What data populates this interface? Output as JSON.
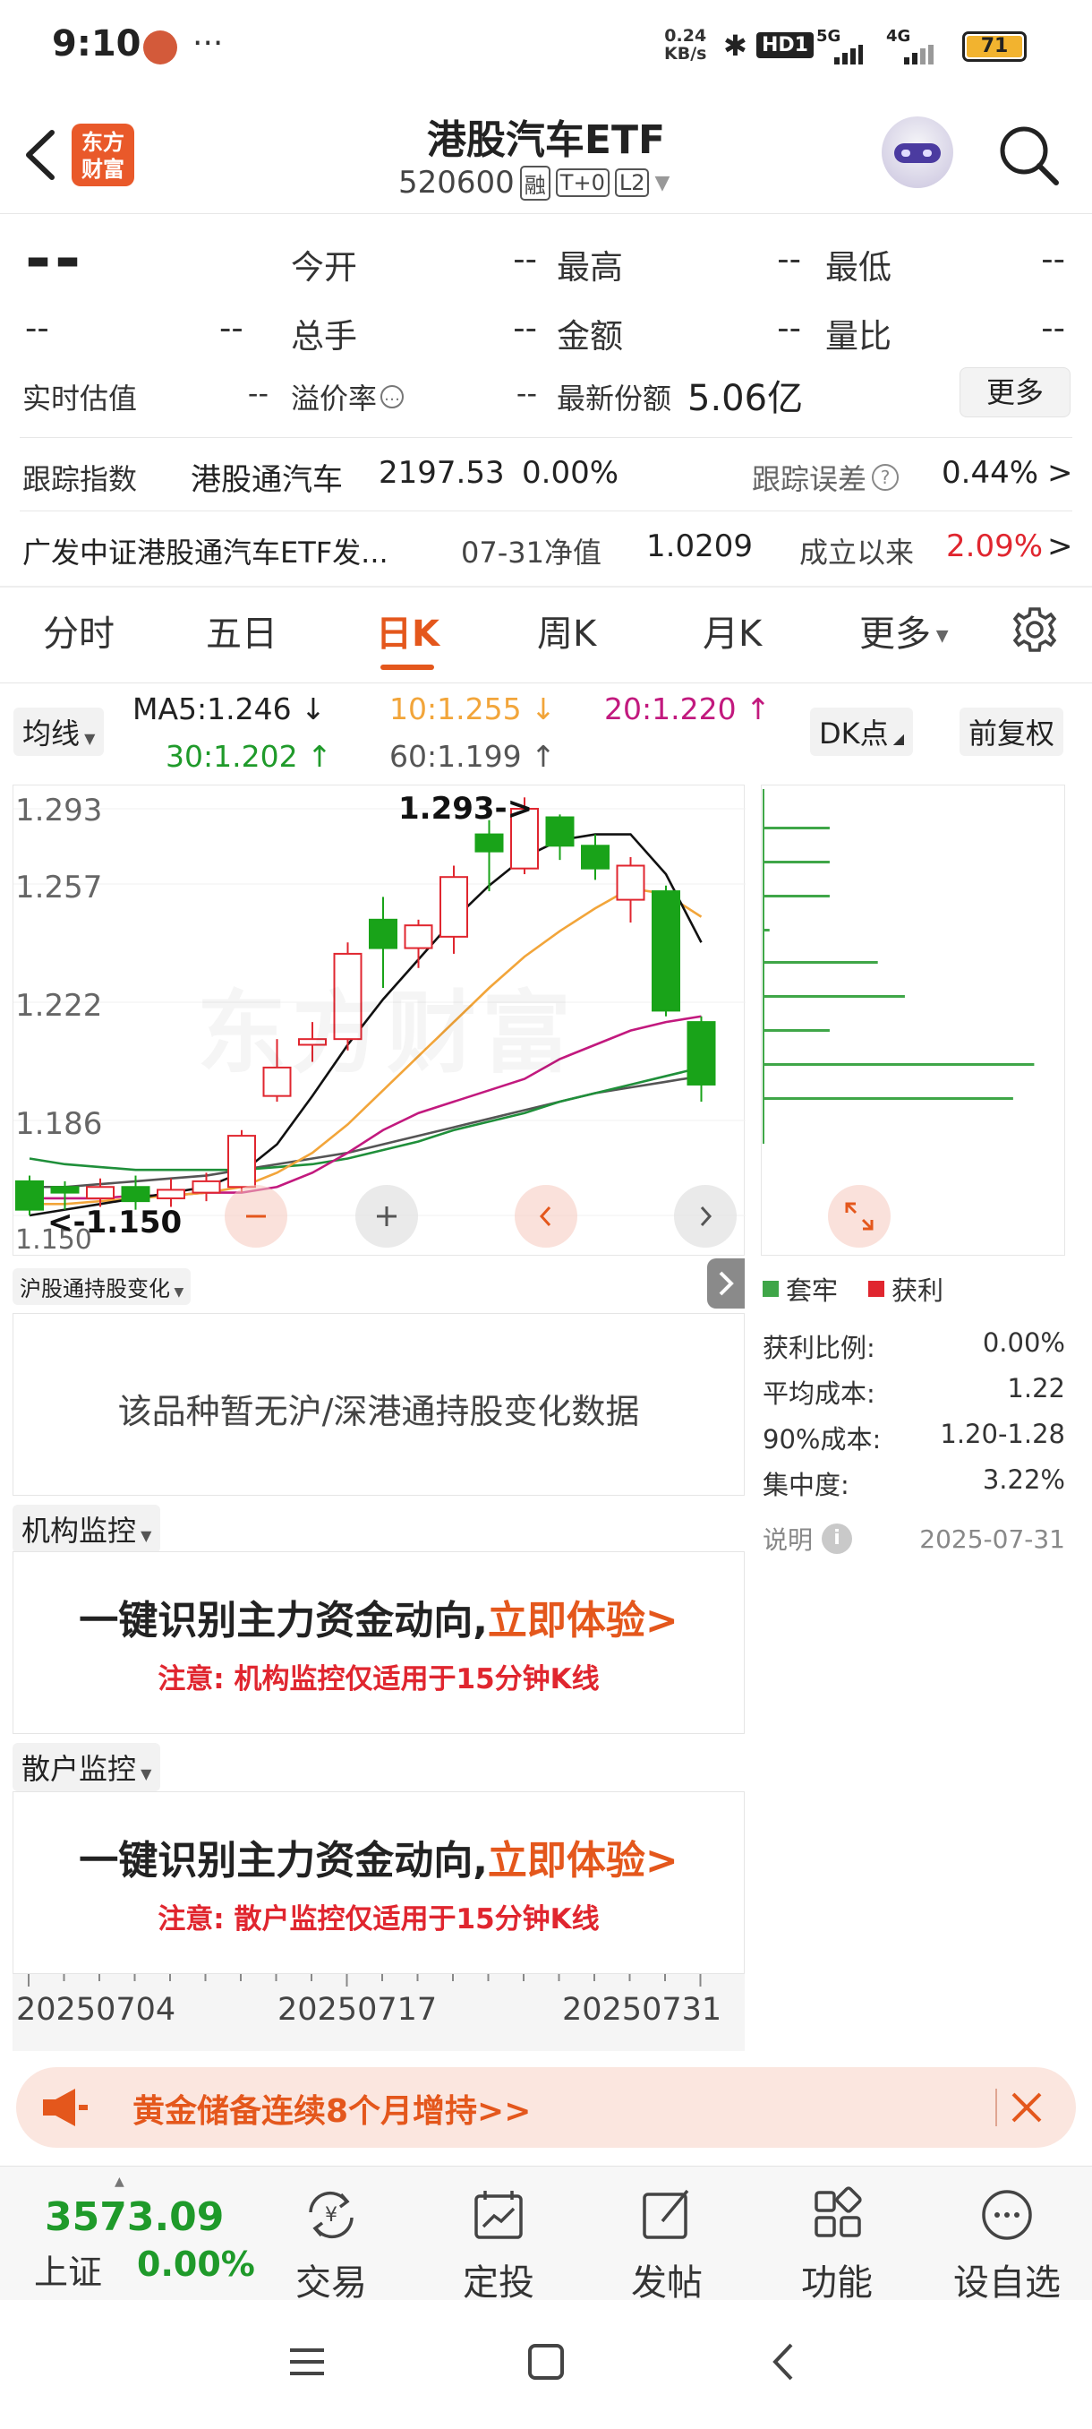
{
  "status_bar": {
    "time": "9:10",
    "dots": "···",
    "net_speed_top": "0.24",
    "net_speed_bottom": "KB/s",
    "hd": "HD1",
    "five_g": "5G",
    "four_g": "4G",
    "battery": "71"
  },
  "header": {
    "logo_line1": "东方",
    "logo_line2": "财富",
    "title": "港股汽车ETF",
    "code": "520600",
    "badge_rong": "融",
    "badge_t0": "T+0",
    "badge_l2": "L2"
  },
  "quote": {
    "price": "--",
    "change": "--",
    "change_pct": "--",
    "open_label": "今开",
    "open": "--",
    "high_label": "最高",
    "high": "--",
    "low_label": "最低",
    "low": "--",
    "volume_label": "总手",
    "volume": "--",
    "amount_label": "金额",
    "amount": "--",
    "ratio_label": "量比",
    "ratio": "--",
    "iopv_label": "实时估值",
    "iopv": "--",
    "premium_label": "溢价率",
    "premium": "--",
    "shares_label": "最新份额",
    "shares": "5.06亿",
    "more_btn": "更多"
  },
  "tracking": {
    "label": "跟踪指数",
    "index_name": "港股通汽车",
    "index_value": "2197.53",
    "index_change": "0.00%",
    "error_label": "跟踪误差",
    "error_value": "0.44%",
    "arrow": ">"
  },
  "fund": {
    "name": "广发中证港股通汽车ETF发...",
    "nav_label": "07-31净值",
    "nav": "1.0209",
    "since_label": "成立以来",
    "since": "2.09%",
    "arrow": ">"
  },
  "tabs": [
    "分时",
    "五日",
    "日K",
    "周K",
    "月K",
    "更多"
  ],
  "chart_header": {
    "ma_btn": "均线",
    "ma5": "MA5:1.246",
    "ma5_arrow": "↓",
    "ma10": "10:1.255",
    "ma10_arrow": "↓",
    "ma20": "20:1.220",
    "ma20_arrow": "↑",
    "ma30": "30:1.202",
    "ma30_arrow": "↑",
    "ma60": "60:1.199",
    "ma60_arrow": "↑",
    "dk_btn": "DK点",
    "adjust_btn": "前复权"
  },
  "chart_data": {
    "type": "candlestick",
    "y_ticks": [
      "1.293",
      "1.257",
      "1.222",
      "1.186",
      "1.150"
    ],
    "ylim": [
      1.15,
      1.293
    ],
    "max_label": "1.293->",
    "min_label": "<-1.150",
    "watermark": "东方财富",
    "x_ticks": [
      "20250704",
      "20250717",
      "20250731"
    ],
    "candles": [
      {
        "o": 1.162,
        "c": 1.152,
        "h": 1.164,
        "l": 1.15
      },
      {
        "o": 1.16,
        "c": 1.158,
        "h": 1.162,
        "l": 1.152
      },
      {
        "o": 1.156,
        "c": 1.16,
        "h": 1.163,
        "l": 1.153
      },
      {
        "o": 1.16,
        "c": 1.155,
        "h": 1.164,
        "l": 1.152
      },
      {
        "o": 1.156,
        "c": 1.159,
        "h": 1.163,
        "l": 1.153
      },
      {
        "o": 1.158,
        "c": 1.162,
        "h": 1.165,
        "l": 1.155
      },
      {
        "o": 1.16,
        "c": 1.178,
        "h": 1.18,
        "l": 1.158
      },
      {
        "o": 1.192,
        "c": 1.202,
        "h": 1.212,
        "l": 1.19
      },
      {
        "o": 1.21,
        "c": 1.212,
        "h": 1.218,
        "l": 1.204
      },
      {
        "o": 1.212,
        "c": 1.242,
        "h": 1.246,
        "l": 1.208
      },
      {
        "o": 1.254,
        "c": 1.244,
        "h": 1.262,
        "l": 1.23
      },
      {
        "o": 1.244,
        "c": 1.252,
        "h": 1.254,
        "l": 1.237
      },
      {
        "o": 1.248,
        "c": 1.269,
        "h": 1.273,
        "l": 1.242
      },
      {
        "o": 1.284,
        "c": 1.278,
        "h": 1.289,
        "l": 1.264
      },
      {
        "o": 1.272,
        "c": 1.293,
        "h": 1.297,
        "l": 1.27
      },
      {
        "o": 1.29,
        "c": 1.28,
        "h": 1.291,
        "l": 1.275
      },
      {
        "o": 1.28,
        "c": 1.272,
        "h": 1.284,
        "l": 1.268
      },
      {
        "o": 1.261,
        "c": 1.273,
        "h": 1.276,
        "l": 1.253
      },
      {
        "o": 1.264,
        "c": 1.222,
        "h": 1.266,
        "l": 1.22
      },
      {
        "o": 1.218,
        "c": 1.196,
        "h": 1.22,
        "l": 1.19
      }
    ],
    "ma5": [
      1.15,
      1.152,
      1.154,
      1.156,
      1.158,
      1.16,
      1.165,
      1.175,
      1.192,
      1.21,
      1.226,
      1.24,
      1.254,
      1.266,
      1.276,
      1.282,
      1.284,
      1.284,
      1.27,
      1.246
    ],
    "ma10": [
      1.154,
      1.154,
      1.155,
      1.156,
      1.157,
      1.158,
      1.16,
      1.165,
      1.172,
      1.182,
      1.194,
      1.206,
      1.218,
      1.23,
      1.241,
      1.25,
      1.258,
      1.265,
      1.263,
      1.255
    ],
    "ma20": [
      1.156,
      1.156,
      1.156,
      1.157,
      1.157,
      1.158,
      1.158,
      1.16,
      1.165,
      1.172,
      1.18,
      1.186,
      1.19,
      1.194,
      1.198,
      1.205,
      1.21,
      1.215,
      1.218,
      1.22
    ],
    "ma30": [
      1.17,
      1.168,
      1.167,
      1.166,
      1.166,
      1.166,
      1.166,
      1.167,
      1.168,
      1.17,
      1.173,
      1.176,
      1.18,
      1.183,
      1.186,
      1.19,
      1.193,
      1.196,
      1.199,
      1.202
    ],
    "ma60": [
      1.16,
      1.16,
      1.161,
      1.162,
      1.163,
      1.164,
      1.166,
      1.168,
      1.17,
      1.172,
      1.175,
      1.178,
      1.181,
      1.184,
      1.187,
      1.19,
      1.193,
      1.195,
      1.197,
      1.199
    ],
    "chip_bars": [
      0.22,
      0.22,
      0.22,
      0.02,
      0.38,
      0.47,
      0.22,
      0.9,
      0.83
    ],
    "colors": {
      "up": "#e0262f",
      "down": "#19a319",
      "ma5": "#111111",
      "ma10": "#f2a53a",
      "ma20": "#c2197e",
      "ma30": "#1f8f3a",
      "ma60": "#555555"
    }
  },
  "chips": {
    "legend_trapped": "套牢",
    "legend_profit": "获利",
    "profit_ratio_label": "获利比例:",
    "profit_ratio": "0.00%",
    "avg_cost_label": "平均成本:",
    "avg_cost": "1.22",
    "cost90_label": "90%成本:",
    "cost90": "1.20-1.28",
    "concentration_label": "集中度:",
    "concentration": "3.22%",
    "note_label": "说明",
    "note_date": "2025-07-31"
  },
  "hk_panel": {
    "dropdown": "沪股通持股变化",
    "empty_text": "该品种暂无沪/深港通持股变化数据"
  },
  "inst_panel": {
    "dropdown": "机构监控",
    "headline": "一键识别主力资金动向,",
    "cta": "立即体验>",
    "note": "注意: 机构监控仅适用于15分钟K线"
  },
  "retail_panel": {
    "dropdown": "散户监控",
    "headline": "一键识别主力资金动向,",
    "cta": "立即体验>",
    "note": "注意: 散户监控仅适用于15分钟K线"
  },
  "banner": {
    "text": "黄金储备连续8个月增持>>"
  },
  "bottom_bar": {
    "index_value": "3573.09",
    "index_name": "上证",
    "index_change": "0.00%",
    "trade": "交易",
    "invest": "定投",
    "post": "发帖",
    "features": "功能",
    "watchlist": "设自选"
  }
}
